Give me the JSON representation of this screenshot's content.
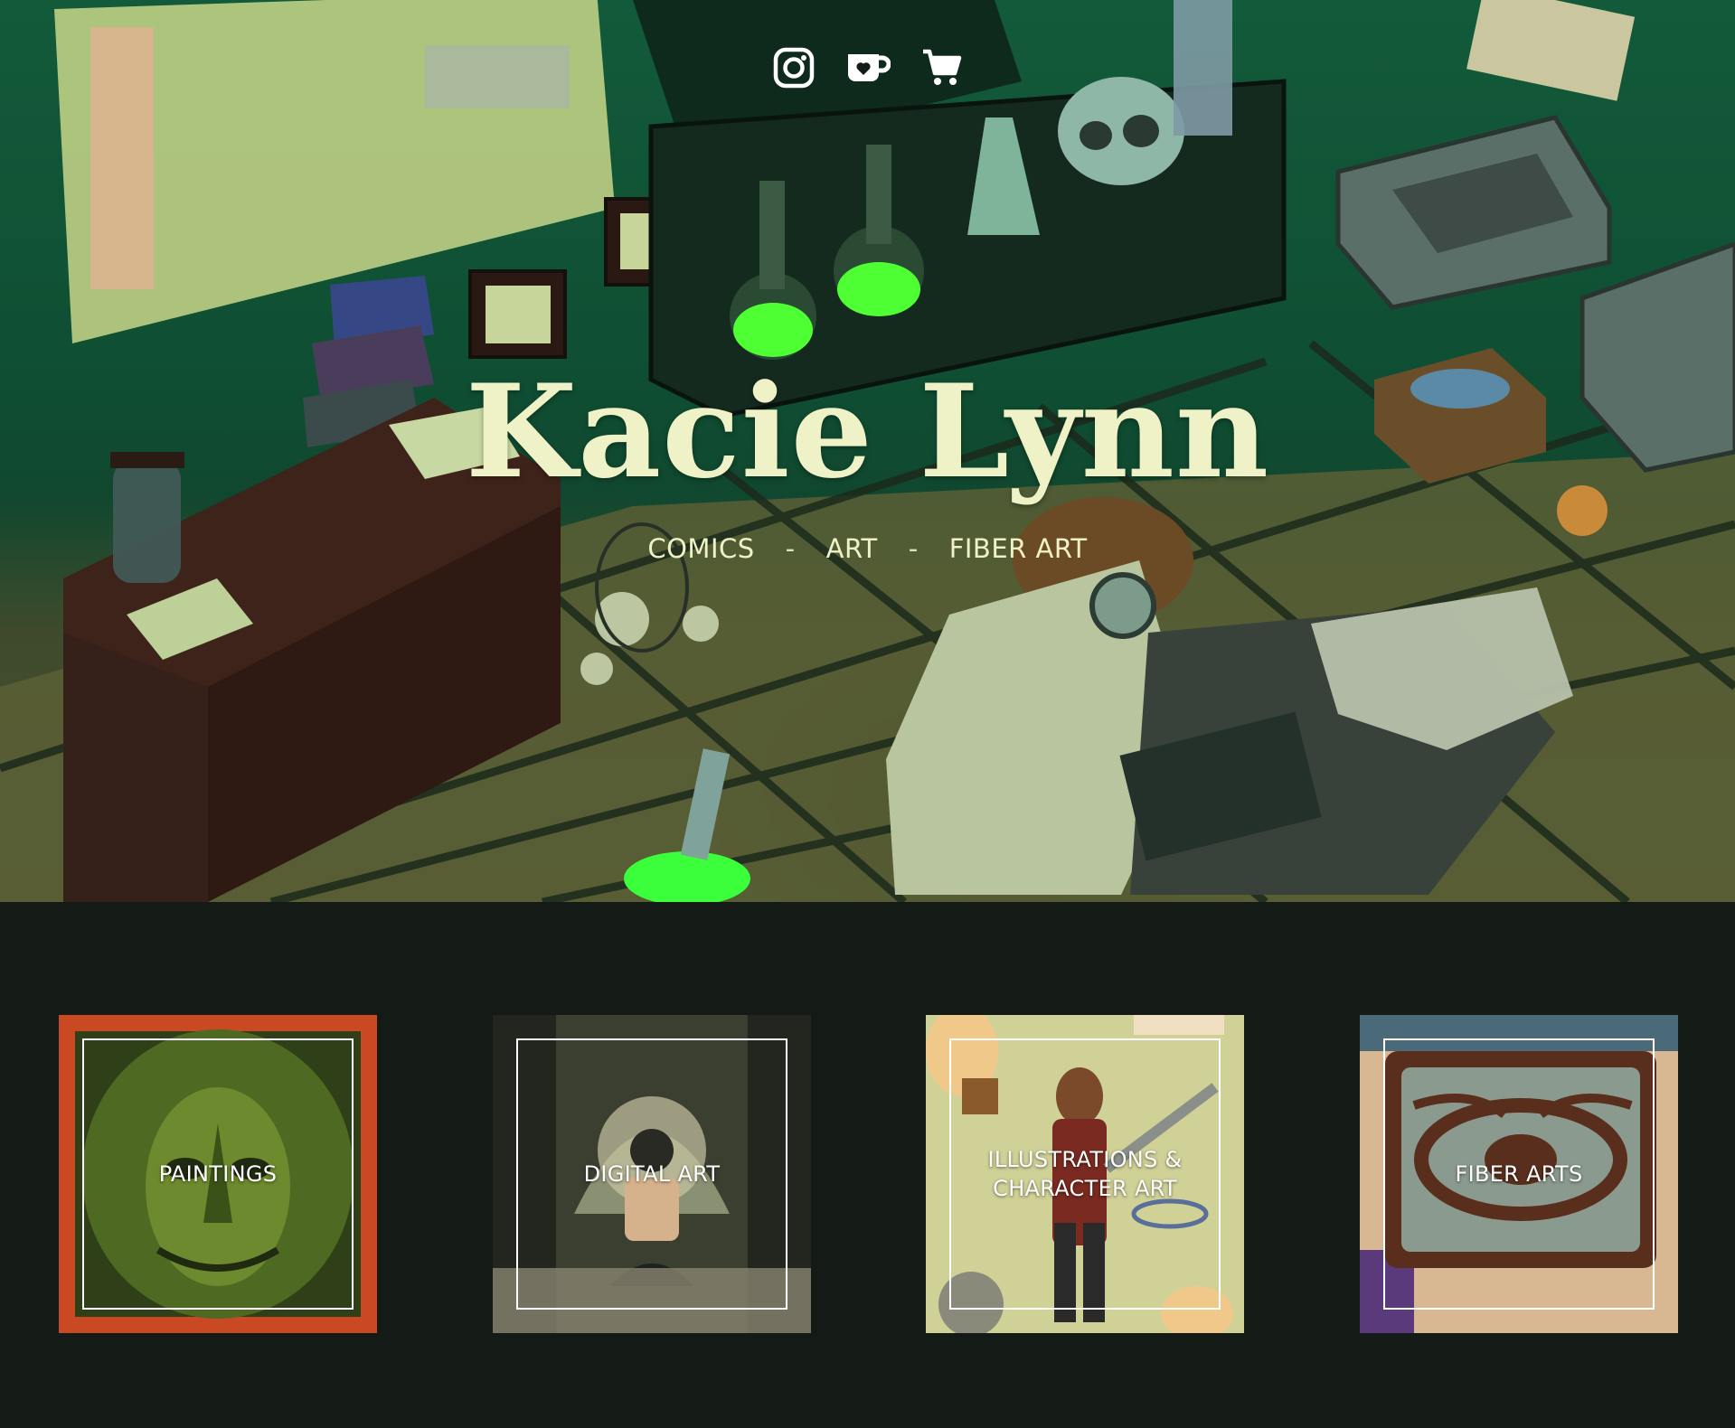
{
  "site": {
    "title": "Kacie Lynn",
    "subnav": [
      {
        "label": "COMICS"
      },
      {
        "label": "ART"
      },
      {
        "label": "FIBER ART"
      }
    ],
    "separator": "-"
  },
  "social": [
    {
      "icon": "instagram-icon"
    },
    {
      "icon": "ko-fi-icon"
    },
    {
      "icon": "shopping-cart-icon"
    }
  ],
  "gallery": [
    {
      "label": "PAINTINGS"
    },
    {
      "label": "DIGITAL ART"
    },
    {
      "label": "ILLUSTRATIONS & CHARACTER ART"
    },
    {
      "label": "FIBER ARTS"
    }
  ],
  "colors": {
    "title": "#eef2c6",
    "page_bg": "#141a16",
    "accent_green": "#3cff3c"
  }
}
